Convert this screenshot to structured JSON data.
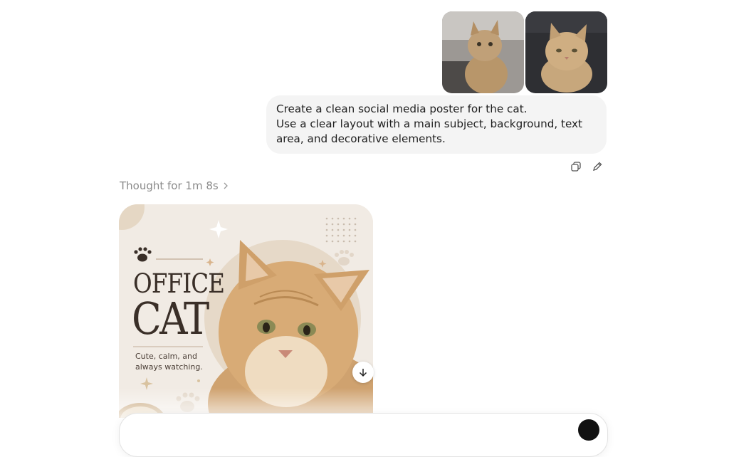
{
  "attachments": [
    {
      "name": "cat-photo-1",
      "icon": "image-thumbnail"
    },
    {
      "name": "cat-photo-2",
      "icon": "image-thumbnail"
    }
  ],
  "user_message": {
    "line1": "Create a clean social media poster for the cat.",
    "line2": "Use a clear layout with a main subject, background, text area, and decorative elements."
  },
  "message_actions": {
    "copy_icon": "copy-icon",
    "edit_icon": "edit-pencil-icon"
  },
  "thought": {
    "label": "Thought for 1m 8s",
    "icon": "chevron-right-icon"
  },
  "poster": {
    "title_line1": "OFFICE",
    "title_line2": "CAT",
    "tagline": "Cute, calm, and always watching."
  },
  "download_icon": "arrow-down-icon",
  "colors": {
    "poster_bg": "#f1ebe4",
    "poster_text": "#3a2f28",
    "bubble_bg": "#f4f4f4",
    "thought_text": "#8a8a8a"
  }
}
